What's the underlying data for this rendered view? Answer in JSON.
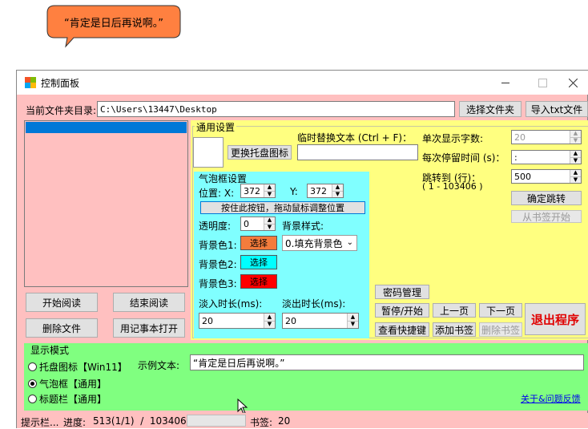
{
  "bubble": {
    "text": "“肯定是日后再说啊。”"
  },
  "window": {
    "title": "控制面板"
  },
  "folder": {
    "label": "当前文件夹目录:",
    "path": "C:\\Users\\13447\\Desktop",
    "choose_btn": "选择文件夹",
    "import_btn": "导入txt文件"
  },
  "file_list": {
    "selected_item": ""
  },
  "left_buttons": {
    "start": "开始阅读",
    "end": "结束阅读",
    "delete": "删除文件",
    "notepad": "用记事本打开"
  },
  "general": {
    "title": "通用设置",
    "replace_icon_btn": "更换托盘图标",
    "temp_replace_label": "临时替换文本 (Ctrl + F)：",
    "temp_replace_value": "",
    "chars_label": "单次显示字数:",
    "chars_value": "20",
    "stay_label": "每次停留时间 (s)：",
    "stay_value": ":",
    "jump_label": "跳转到 (行)：",
    "jump_range": "( 1 - 103406 )",
    "jump_value": "500",
    "jump_btn": "确定跳转",
    "bookmark_start_btn": "从书签开始",
    "password_btn": "密码管理",
    "pause_btn": "暂停/开始",
    "prev_btn": "上一页",
    "next_btn": "下一页",
    "exit_btn": "退出程序",
    "shortcuts_btn": "查看快捷键",
    "add_bookmark_btn": "添加书签",
    "delete_bookmark_btn": "删除书签"
  },
  "bubble_settings": {
    "title": "气泡框设置",
    "pos_label": "位置: X:",
    "x_value": "372",
    "y_label": "Y:",
    "y_value": "372",
    "drag_btn": "按住此按钮，拖动鼠标调整位置",
    "opacity_label": "透明度:",
    "opacity_value": "0",
    "bg_style_label": "背景样式:",
    "bg_style_value": "0.填充背景色",
    "bg1_label": "背景色1:",
    "bg1_color": "#f47c3c",
    "bg2_label": "背景色2:",
    "bg2_color": "#00ffff",
    "bg3_label": "背景色3:",
    "bg3_color": "#ff0000",
    "pick_label": "选择",
    "fade_in_label": "淡入时长(ms):",
    "fade_in_value": "20",
    "fade_out_label": "淡出时长(ms):",
    "fade_out_value": "20"
  },
  "display_mode": {
    "title": "显示模式",
    "options": [
      "托盘图标【Win11】",
      "气泡框【通用】",
      "标题栏【通用】"
    ],
    "selected": 1,
    "sample_label": "示例文本:",
    "sample_text": "“肯定是日后再说啊。”",
    "feedback_link": "关于&问题反馈"
  },
  "status": {
    "hint": "提示栏...",
    "progress_label": "进度:",
    "progress_value": "513(1/1)  /  103406",
    "bookmark_label": "书签:",
    "bookmark_value": "20"
  },
  "colors": {
    "pink": "#ffc0c0",
    "yellow": "#ffff80",
    "cyan": "#80ffff",
    "green": "#80ff80",
    "selection": "#0078d7",
    "bubble": "#ff8040",
    "exit_text": "#e00000"
  }
}
